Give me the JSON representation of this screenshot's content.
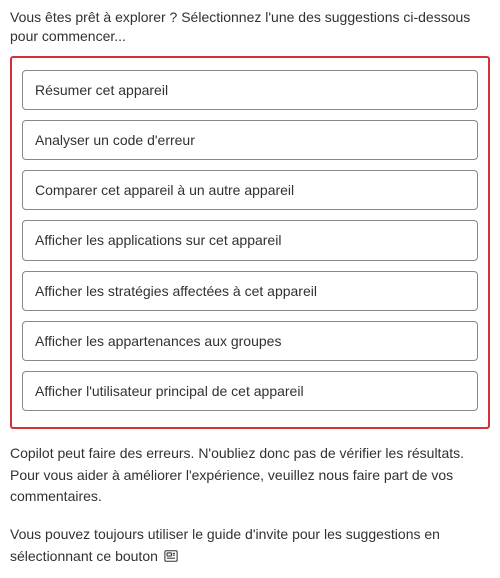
{
  "intro": "Vous êtes prêt à explorer ? Sélectionnez l'une des suggestions ci-dessous pour commencer...",
  "suggestions": {
    "items": [
      {
        "label": "Résumer cet appareil"
      },
      {
        "label": "Analyser un code d'erreur"
      },
      {
        "label": "Comparer cet appareil à un autre appareil"
      },
      {
        "label": "Afficher les applications sur cet appareil"
      },
      {
        "label": "Afficher les stratégies affectées à cet appareil"
      },
      {
        "label": "Afficher les appartenances aux groupes"
      },
      {
        "label": "Afficher l'utilisateur principal de cet appareil"
      }
    ]
  },
  "disclaimer": "Copilot peut faire des erreurs. N'oubliez donc pas de vérifier les résultats. Pour vous aider à améliorer l'expérience, veuillez nous faire part de vos commentaires.",
  "guide_text": "Vous pouvez toujours utiliser le guide d'invite pour les suggestions en sélectionnant ce bouton",
  "icons": {
    "prompt_guide": "prompt-guide-icon"
  }
}
